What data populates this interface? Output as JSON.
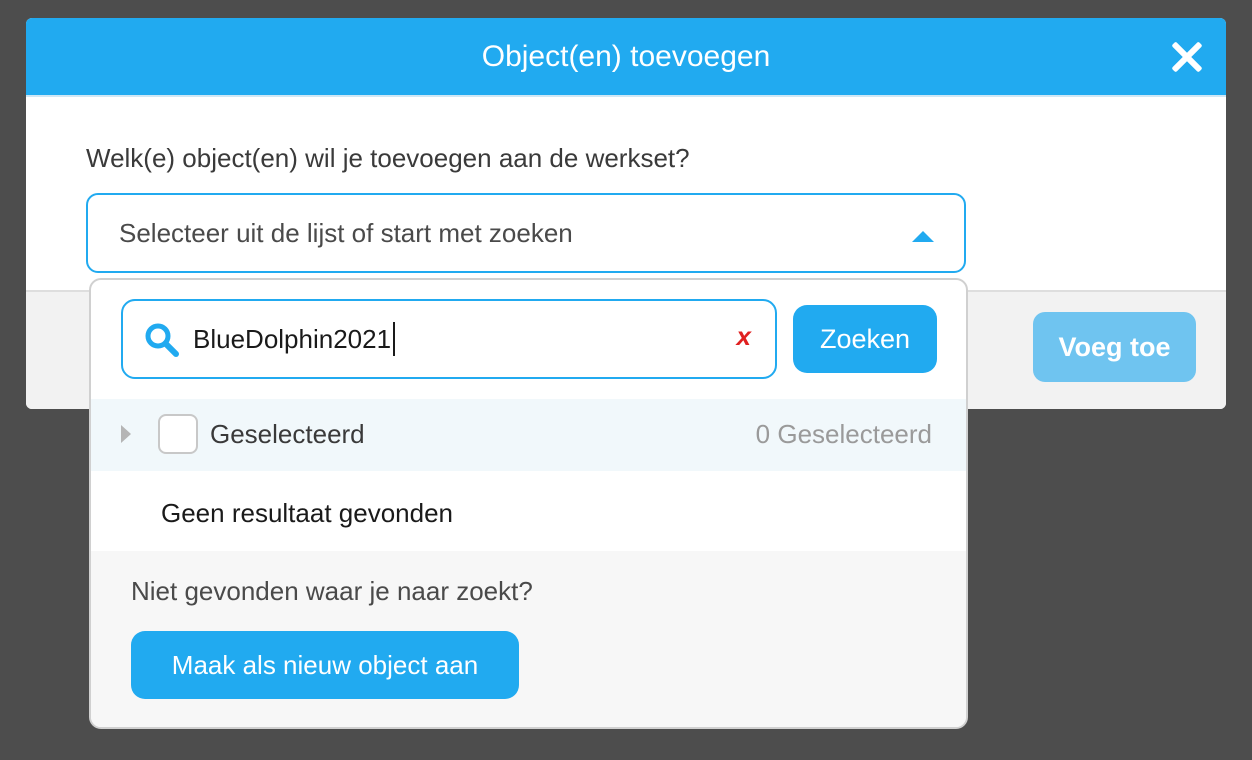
{
  "modal": {
    "title": "Object(en) toevoegen",
    "question": "Welk(e) object(en) wil je toevoegen aan de werkset?",
    "select_placeholder": "Selecteer uit de lijst of start met zoeken",
    "add_button": "Voeg toe"
  },
  "dropdown": {
    "search_value": "BlueDolphin2021",
    "clear_icon": "x",
    "search_button": "Zoeken",
    "selected_label": "Geselecteerd",
    "selected_count": "0 Geselecteerd",
    "no_result": "Geen resultaat gevonden",
    "not_found_prompt": "Niet gevonden waar je naar zoekt?",
    "create_button": "Maak als nieuw object aan"
  },
  "icons": {
    "close": "close-icon",
    "search": "search-icon",
    "caret_up": "chevron-up-icon",
    "caret_right": "chevron-right-icon",
    "clear": "clear-icon"
  },
  "colors": {
    "accent": "#21aaf0",
    "accent_disabled": "#6fc4f0",
    "clear_red": "#e02020",
    "backdrop": "#4d4d4d"
  }
}
